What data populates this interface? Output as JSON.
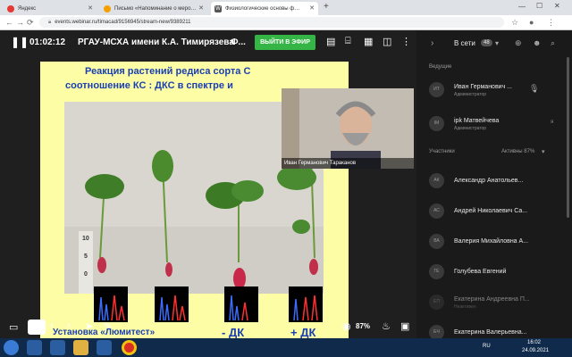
{
  "browser": {
    "tabs": [
      {
        "label": "Яндекс",
        "color": "#e53935"
      },
      {
        "label": "Письмо «Напоминание о меро…",
        "color": "#f4a000"
      },
      {
        "label": "Физиологические основы ф…",
        "color": "#555555"
      }
    ],
    "url": "events.webinar.ru/timacad/9156945/stream-new/9389211",
    "new_tab": "+"
  },
  "topbar": {
    "timer": "01:02:12",
    "title": "РГАУ-МСХА имени К.А. Тимирязева",
    "title_suffix": "Ф...",
    "live_button": "ВЫЙТИ В ЭФИР"
  },
  "slide": {
    "heading_line1": "Реакция растений редиса сорта С",
    "heading_line2": "соотношение КС : ДКС в спектре и",
    "ruler": [
      "10",
      "5",
      "0"
    ],
    "caption_left": "Установка «Люмитест»",
    "caption_mid": "- ДК",
    "caption_right": "+ ДК"
  },
  "video": {
    "presenter_label": "Иван Германович Тараканов"
  },
  "bottombar": {
    "zoom": "87%"
  },
  "sidebar": {
    "online_label": "В сети",
    "online_count": "48",
    "hosts_label": "Ведущие",
    "participants_label": "Участники",
    "active_label": "Активны 87%",
    "hosts": [
      {
        "initials": "ИТ",
        "name": "Иван Германович ...",
        "role": "Администратор"
      },
      {
        "initials": "IM",
        "name": "ipk Матвейчева",
        "role": "Администратор"
      }
    ],
    "participants": [
      {
        "initials": "АК",
        "name": "Александр Анатольев..."
      },
      {
        "initials": "АС",
        "name": "Андрей Николаевич Са..."
      },
      {
        "initials": "ВА",
        "name": "Валерия Михайловна А..."
      },
      {
        "initials": "ГЕ",
        "name": "Голубева Евгений"
      },
      {
        "initials": "ЕП",
        "name": "Екатерина Андреевна П...",
        "role": "Неактивен"
      },
      {
        "initials": "ЕЧ",
        "name": "Екатерина Валерьевна..."
      }
    ]
  },
  "taskbar": {
    "lang": "RU",
    "time": "16:02",
    "date": "24.09.2021"
  }
}
